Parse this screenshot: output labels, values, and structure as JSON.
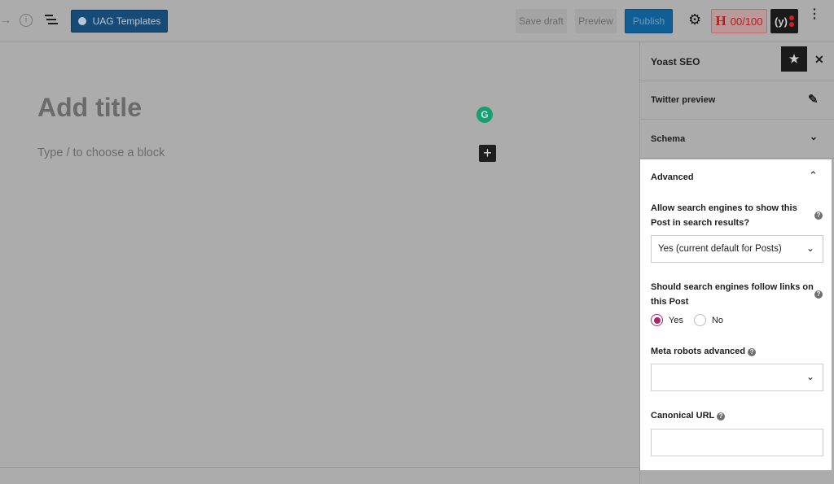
{
  "toolbar": {
    "uag_label": "UAG Templates",
    "save_draft": "Save draft",
    "preview": "Preview",
    "publish": "Publish",
    "score": "00/100",
    "score_letter": "H"
  },
  "editor": {
    "title_placeholder": "Add title",
    "block_placeholder": "Type / to choose a block"
  },
  "sidebar": {
    "title": "Yoast SEO",
    "twitter": "Twitter preview",
    "schema": "Schema",
    "advanced": "Advanced",
    "q1": "Allow search engines to show this Post in search results?",
    "q1_value": "Yes (current default for Posts)",
    "q2": "Should search engines follow links on this Post",
    "yes": "Yes",
    "no": "No",
    "selected": "Yes",
    "meta_robots": "Meta robots advanced",
    "meta_value": "",
    "canonical": "Canonical URL",
    "canonical_value": ""
  },
  "colors": {
    "accent": "#a4286a",
    "publish": "#0f5f96",
    "uag": "#164b78"
  }
}
